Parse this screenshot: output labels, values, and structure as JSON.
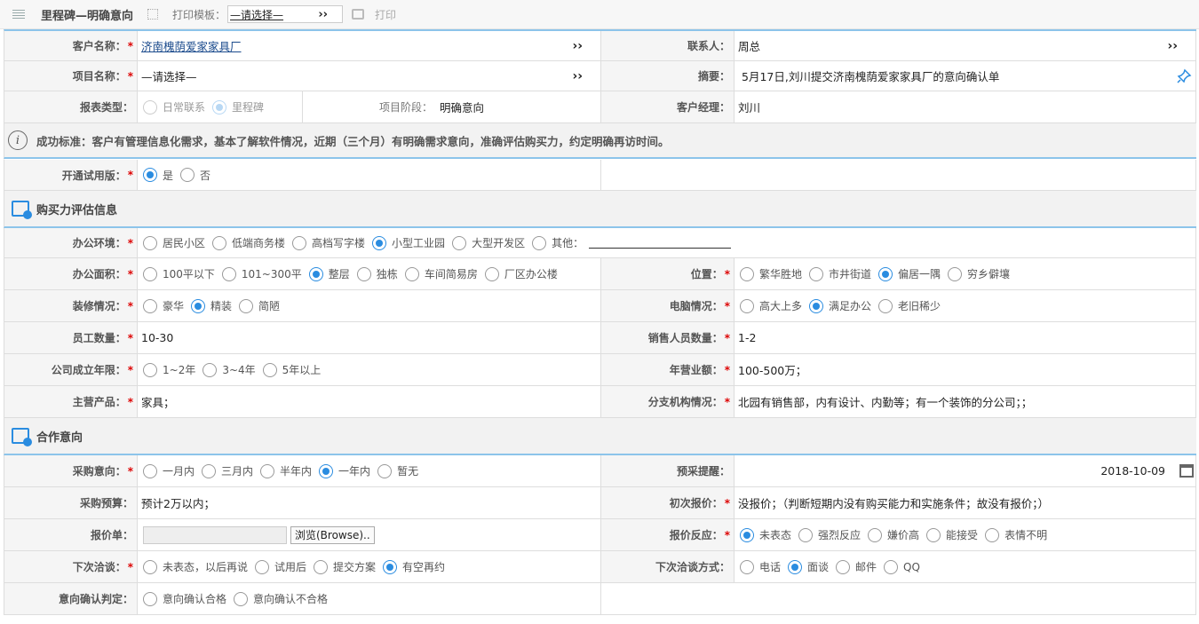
{
  "toolbar": {
    "title": "里程碑—明确意向",
    "print_template_label": "打印模板：",
    "template_value": "—请选择—",
    "print_label": "打印"
  },
  "row_customer": {
    "customer_label": "客户名称：",
    "customer_value": "济南槐荫爱家家具厂",
    "contact_label": "联系人：",
    "contact_value": "周总"
  },
  "row_project": {
    "project_label": "项目名称：",
    "project_value": "—请选择—",
    "summary_label": "摘要：",
    "summary_value": "5月17日,刘川提交济南槐荫爱家家具厂的意向确认单"
  },
  "row_report": {
    "report_type_label": "报表类型：",
    "opt1": "日常联系",
    "opt2": "里程碑",
    "stage_label": "项目阶段：",
    "stage_value": "明确意向",
    "manager_label": "客户经理：",
    "manager_value": "刘川"
  },
  "info": {
    "text": "成功标准：客户有管理信息化需求，基本了解软件情况，近期（三个月）有明确需求意向，准确评估购买力，约定明确再访时间。"
  },
  "trial": {
    "label": "开通试用版：",
    "yes": "是",
    "no": "否"
  },
  "section1": {
    "title": "购买力评估信息"
  },
  "office_env": {
    "label": "办公环境：",
    "options": [
      "居民小区",
      "低端商务楼",
      "高档写字楼",
      "小型工业园",
      "大型开发区",
      "其他："
    ]
  },
  "office_area": {
    "label": "办公面积：",
    "options": [
      "100平以下",
      "101~300平",
      "整层",
      "独栋",
      "车间简易房",
      "厂区办公楼"
    ]
  },
  "location": {
    "label": "位置：",
    "options": [
      "繁华胜地",
      "市井街道",
      "偏居一隅",
      "穷乡僻壤"
    ]
  },
  "decoration": {
    "label": "装修情况：",
    "options": [
      "豪华",
      "精装",
      "简陋"
    ]
  },
  "computers": {
    "label": "电脑情况：",
    "options": [
      "高大上多",
      "满足办公",
      "老旧稀少"
    ]
  },
  "staff": {
    "label": "员工数量：",
    "value": "10-30",
    "sales_label": "销售人员数量：",
    "sales_value": "1-2"
  },
  "founded": {
    "label": "公司成立年限：",
    "options": [
      "1~2年",
      "3~4年",
      "5年以上"
    ],
    "revenue_label": "年营业额：",
    "revenue_value": "100-500万；"
  },
  "product": {
    "label": "主营产品：",
    "value": "家具；",
    "branch_label": "分支机构情况：",
    "branch_value": "北园有销售部，内有设计、内勤等；有一个装饰的分公司；；"
  },
  "section2": {
    "title": "合作意向"
  },
  "purchase_intent": {
    "label": "采购意向：",
    "options": [
      "一月内",
      "三月内",
      "半年内",
      "一年内",
      "暂无"
    ],
    "reminder_label": "预采提醒：",
    "reminder_date": "2018-10-09"
  },
  "budget": {
    "label": "采购预算：",
    "value": "预计2万以内；",
    "first_quote_label": "初次报价：",
    "first_quote_value": "没报价；（判断短期内没有购买能力和实施条件；故没有报价；）"
  },
  "quote_sheet": {
    "label": "报价单：",
    "browse": "浏览(Browse).."
  },
  "quote_reaction": {
    "label": "报价反应：",
    "options": [
      "未表态",
      "强烈反应",
      "嫌价高",
      "能接受",
      "表情不明"
    ]
  },
  "next_talk": {
    "label": "下次洽谈：",
    "options": [
      "未表态，以后再说",
      "试用后",
      "提交方案",
      "有空再约"
    ],
    "method_label": "下次洽谈方式：",
    "method_options": [
      "电话",
      "面谈",
      "邮件",
      "QQ"
    ]
  },
  "intent_judge": {
    "label": "意向确认判定：",
    "options": [
      "意向确认合格",
      "意向确认不合格"
    ]
  }
}
